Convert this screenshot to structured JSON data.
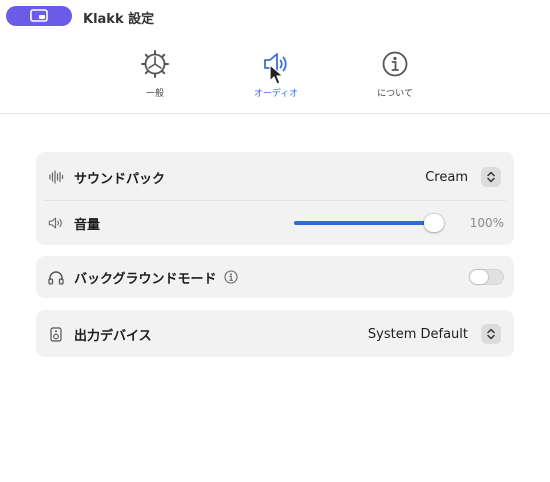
{
  "window": {
    "title": "Klakk 設定"
  },
  "toolbar": {
    "tabs": [
      {
        "id": "general",
        "label": "一般",
        "icon": "gear-icon"
      },
      {
        "id": "audio",
        "label": "オーディオ",
        "icon": "speaker-icon",
        "active": true
      },
      {
        "id": "about",
        "label": "について",
        "icon": "info-icon"
      }
    ]
  },
  "sound_pack": {
    "label": "サウンドパック",
    "value": "Cream",
    "icon": "waveform-icon"
  },
  "volume": {
    "label": "音量",
    "value_text": "100%",
    "level": 1.0,
    "icon": "speaker-icon"
  },
  "background_mode": {
    "label": "バックグラウンドモード",
    "enabled": false,
    "icon": "headphones-icon"
  },
  "output_device": {
    "label": "出力デバイス",
    "value": "System Default",
    "icon": "speaker-box-icon"
  },
  "colors": {
    "accent": "#3b6fd6",
    "slider_fill": "#2f6bd8",
    "app_pill": "#6b5ce7"
  }
}
